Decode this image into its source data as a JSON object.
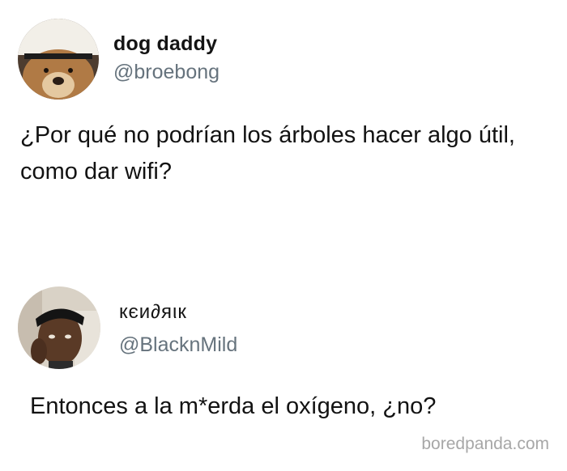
{
  "tweets": [
    {
      "display_name": "dog daddy",
      "handle": "@broebong",
      "text": "¿Por qué no podrían los árboles hacer algo útil, como dar wifi?"
    },
    {
      "display_name": "кєи∂яιк",
      "handle": "@BlacknMild",
      "text": "Entonces a la m*erda el oxígeno, ¿no?"
    }
  ],
  "watermark": "boredpanda.com",
  "colors": {
    "text": "#141414",
    "handle": "#66737d",
    "watermark": "#a7a7a7"
  }
}
